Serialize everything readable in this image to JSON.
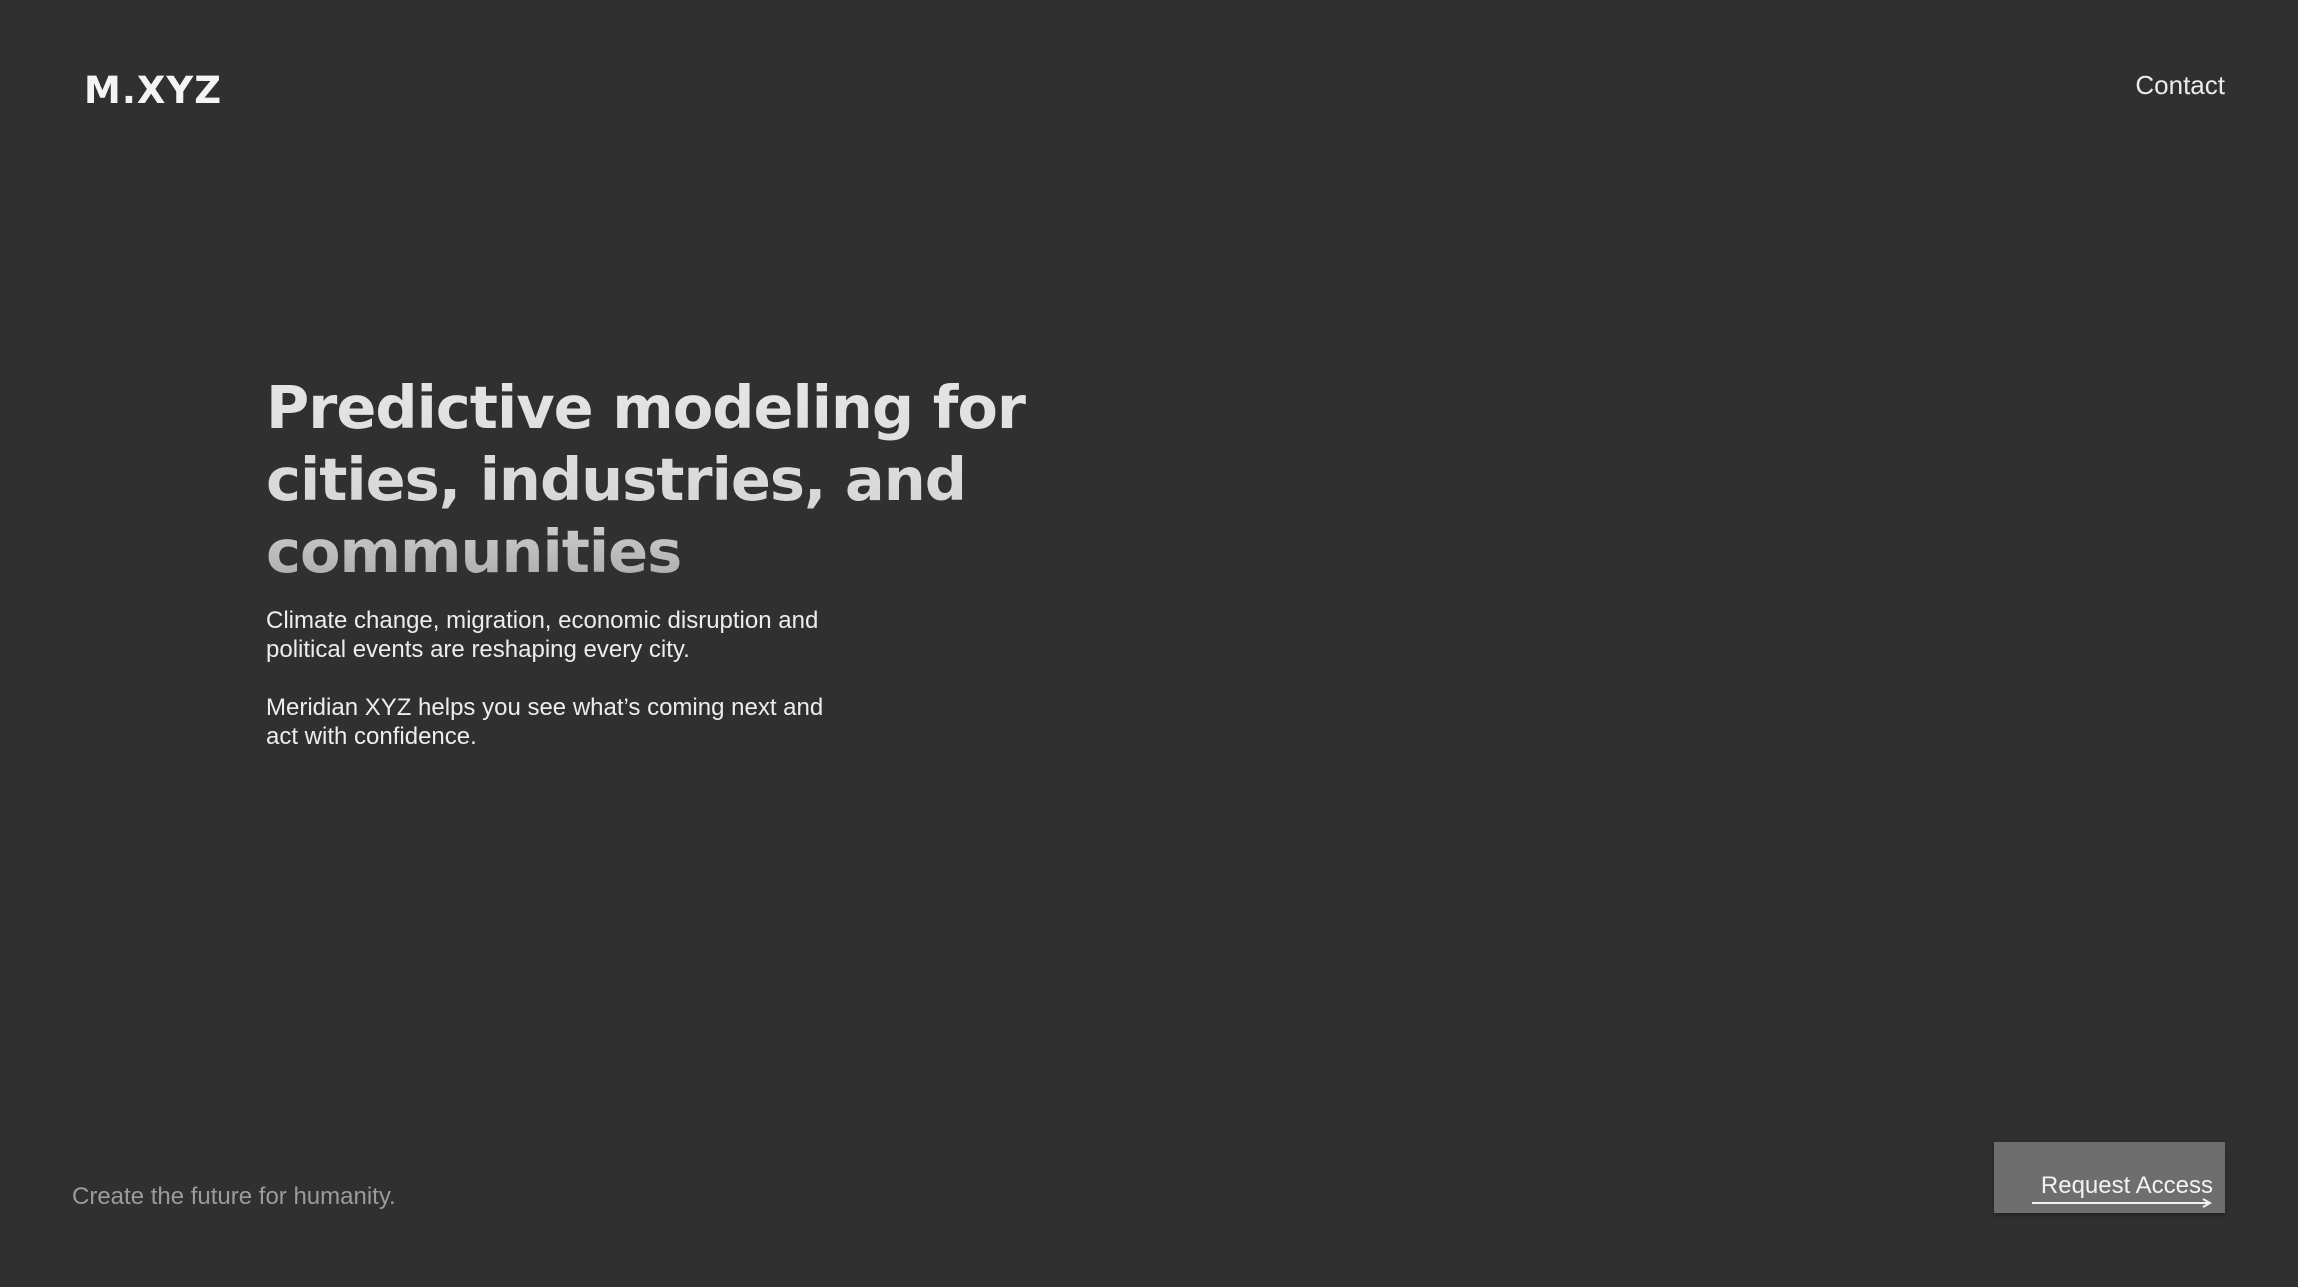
{
  "header": {
    "logo": "M.XYZ",
    "nav_contact": "Contact"
  },
  "hero": {
    "title": "Predictive modeling for cities, industries, and communities",
    "paragraph_1": "Climate change, migration, economic disruption and political events are reshaping every city.",
    "paragraph_2": "Meridian XYZ helps you see what’s coming next and act with confidence."
  },
  "footer": {
    "tagline": "Create the future for humanity.",
    "cta_label": "Request Access",
    "cta_icon": "arrow-right-icon"
  },
  "colors": {
    "background": "#303030",
    "text": "#e9e9e9",
    "muted_text": "#9b9b9b",
    "button_background": "#6e6e6e"
  }
}
